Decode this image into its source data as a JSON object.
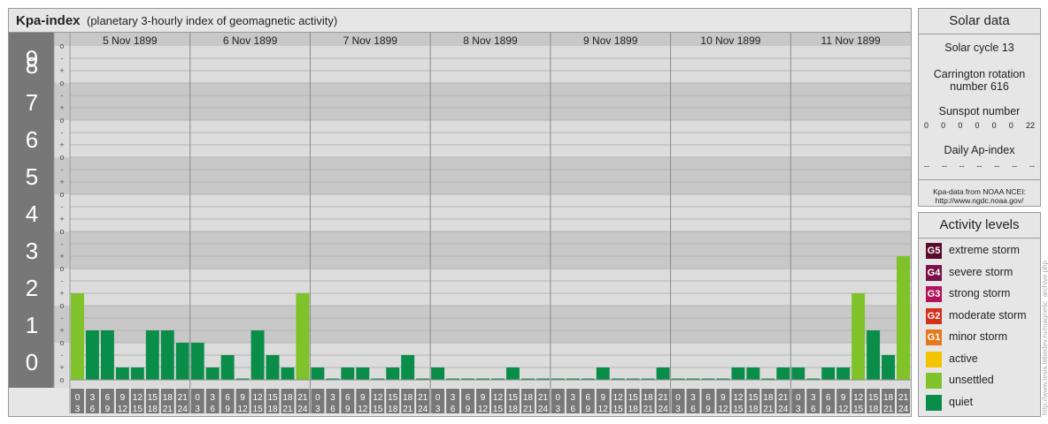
{
  "header": {
    "title": "Kpa-index",
    "subtitle": "(planetary 3-hourly index of geomagnetic activity)"
  },
  "chart_data": {
    "type": "bar",
    "ylim": [
      0,
      9
    ],
    "y_ticks": [
      "0",
      "1",
      "2",
      "3",
      "4",
      "5",
      "6",
      "7",
      "8",
      "9"
    ],
    "minor_ticks": [
      "o",
      "+",
      "-",
      "o"
    ],
    "days": [
      "5 Nov 1899",
      "6 Nov 1899",
      "7 Nov 1899",
      "8 Nov 1899",
      "9 Nov 1899",
      "10 Nov 1899",
      "11 Nov 1899"
    ],
    "slot_labels": [
      [
        "0",
        "3"
      ],
      [
        "3",
        "6"
      ],
      [
        "6",
        "9"
      ],
      [
        "9",
        "12"
      ],
      [
        "12",
        "15"
      ],
      [
        "15",
        "18"
      ],
      [
        "18",
        "21"
      ],
      [
        "21",
        "24"
      ]
    ],
    "values": [
      2.333,
      1.333,
      1.333,
      0.333,
      0.333,
      1.333,
      1.333,
      1.0,
      1.0,
      0.333,
      0.667,
      0.0,
      1.333,
      0.667,
      0.333,
      2.333,
      0.333,
      0.0,
      0.333,
      0.333,
      0.0,
      0.333,
      0.667,
      0.0,
      0.333,
      0.0,
      0.0,
      0.0,
      0.0,
      0.333,
      0.0,
      0.0,
      0.0,
      0.0,
      0.0,
      0.333,
      0.0,
      0.0,
      0.0,
      0.333,
      0.0,
      0.0,
      0.0,
      0.0,
      0.333,
      0.333,
      0.0,
      0.333,
      0.333,
      0.0,
      0.333,
      0.333,
      2.333,
      1.333,
      0.667,
      3.333
    ],
    "colors": {
      "quiet": "#0b8d4a",
      "unsettled": "#7fc22a",
      "active": "#f5c400",
      "band_dark": "#c8c8c8",
      "band_light": "#dcdcdc",
      "label_bg": "#777777",
      "grid": "#b4b4b4"
    }
  },
  "solar": {
    "title": "Solar data",
    "cycle": "Solar cycle 13",
    "carrington": "Carrington rotation number 616",
    "sunspot_label": "Sunspot number",
    "sunspots": [
      "0",
      "0",
      "0",
      "0",
      "0",
      "0",
      "22"
    ],
    "ap_label": "Daily Ap-index",
    "ap_values": [
      "--",
      "--",
      "--",
      "--",
      "--",
      "--",
      "--"
    ],
    "source": "Kpa-data from NOAA NCEI:",
    "source_url": "http://www.ngdc.noaa.gov/"
  },
  "activity": {
    "title": "Activity levels",
    "levels": [
      {
        "code": "G5",
        "label": "extreme storm",
        "color": "#5b0a2c"
      },
      {
        "code": "G4",
        "label": "severe storm",
        "color": "#7a0f4a"
      },
      {
        "code": "G3",
        "label": "strong storm",
        "color": "#b3125c"
      },
      {
        "code": "G2",
        "label": "moderate storm",
        "color": "#d4301b"
      },
      {
        "code": "G1",
        "label": "minor storm",
        "color": "#e5771c"
      },
      {
        "code": "",
        "label": "active",
        "color": "#f5c400"
      },
      {
        "code": "",
        "label": "unsettled",
        "color": "#7fc22a"
      },
      {
        "code": "",
        "label": "quiet",
        "color": "#0b8d4a"
      }
    ]
  },
  "watermark": "http://www.tesis.lebedev.ru/magnetic_archive.php"
}
